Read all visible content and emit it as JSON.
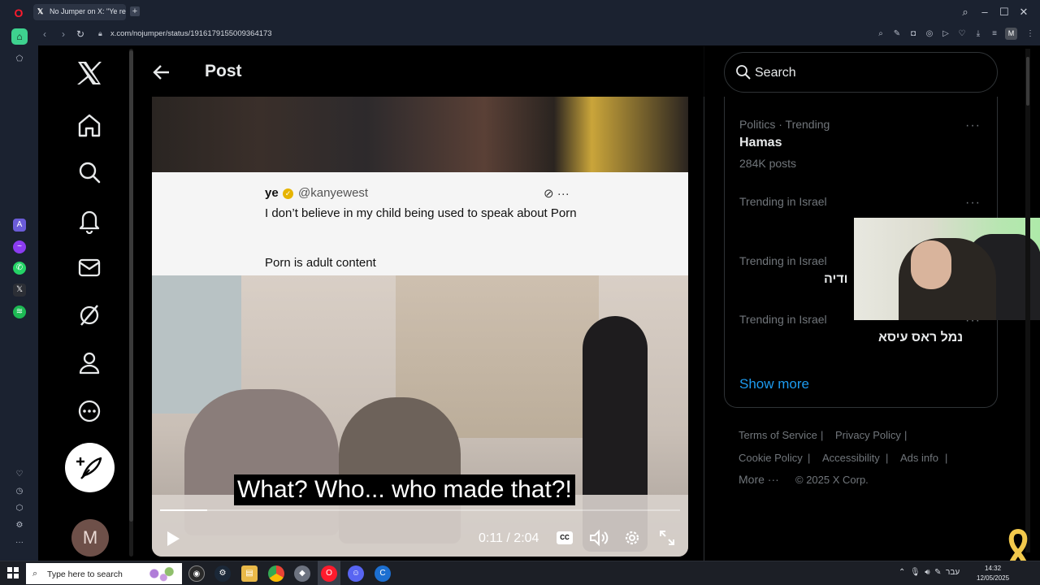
{
  "browser": {
    "tab_title": "No Jumper on X: \"Ye react",
    "url": "x.com/nojumper/status/1916179155009364173",
    "profile_initial": "M"
  },
  "x_nav": {
    "avatar_initial": "M"
  },
  "header": {
    "title": "Post"
  },
  "video": {
    "tweet_name": "ye",
    "tweet_handle": "@kanyewest",
    "tweet_line1": "I don’t believe in my child being used to speak about Porn",
    "tweet_line2": "Porn is adult content",
    "tweet_icons": "⊘ ···",
    "subtitle": "What? Who... who made that?!",
    "time": "0:11 / 2:04",
    "cc_label": "CC",
    "progress": 0.09
  },
  "search": {
    "placeholder": "Search"
  },
  "trends": [
    {
      "meta": "Politics · Trending",
      "name": "Hamas",
      "posts": "284K posts"
    },
    {
      "meta": "Trending in Israel",
      "name": "",
      "posts": ""
    },
    {
      "meta": "Trending in Israel",
      "name": "ודיה",
      "posts": ""
    },
    {
      "meta": "Trending in Israel",
      "name": "נמל ראס עיסא",
      "posts": ""
    }
  ],
  "show_more": "Show more",
  "footer": {
    "terms": "Terms of Service",
    "privacy": "Privacy Policy",
    "cookie": "Cookie Policy",
    "accessibility": "Accessibility",
    "ads": "Ads info",
    "more": "More ···",
    "copyright": "© 2025 X Corp."
  },
  "taskbar": {
    "search_placeholder": "Type here to search",
    "language": "עבר",
    "time": "14:32",
    "date": "12/05/2025"
  },
  "colors": {
    "accent_blue": "#1d9bf0",
    "text_primary": "#e7e9ea",
    "text_secondary": "#71767b",
    "border": "#2f3336",
    "opera_green": "#3ed28f",
    "ribbon_yellow": "#f2c94c"
  }
}
